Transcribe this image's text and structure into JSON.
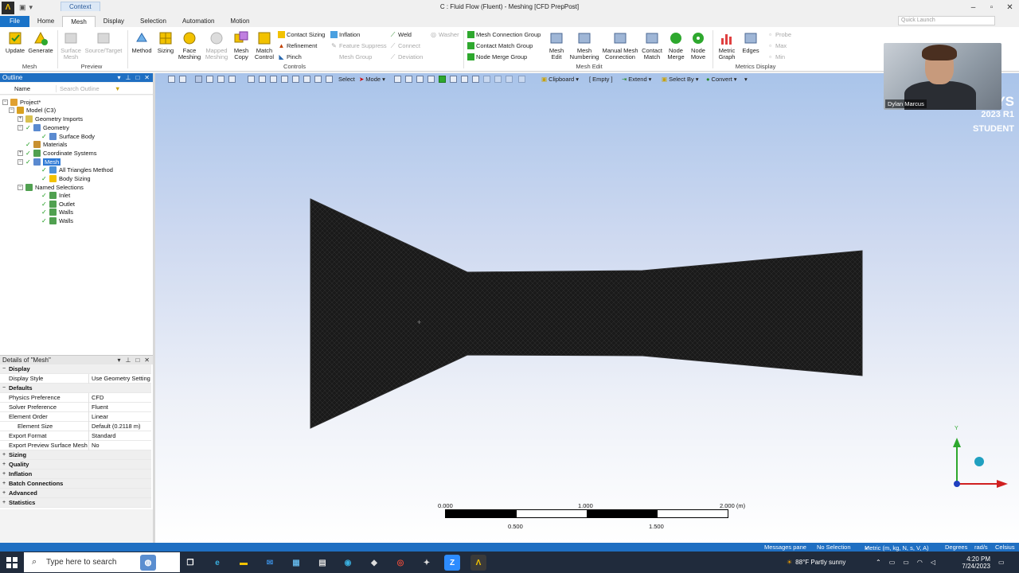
{
  "window": {
    "title": "C : Fluid Flow (Fluent) - Meshing [CFD PrepPost]",
    "context_tab": "Context",
    "controls": [
      "–",
      "▫",
      "✕"
    ]
  },
  "ribbon_tabs": [
    "File",
    "Home",
    "Mesh",
    "Display",
    "Selection",
    "Automation",
    "Motion"
  ],
  "quick_launch": "Quick Launch",
  "ribbon": {
    "update": "Update",
    "generate": "Generate",
    "group_mesh": "Mesh",
    "surface_mesh": "Surface\nMesh",
    "source_target": "Source/Target",
    "group_preview": "Preview",
    "method": "Method",
    "sizing": "Sizing",
    "face_meshing": "Face\nMeshing",
    "mapped_meshing": "Mapped\nMeshing",
    "mesh_copy": "Mesh\nCopy",
    "match_control": "Match\nControl",
    "contact_sizing": "Contact Sizing",
    "refinement": "Refinement",
    "pinch": "Pinch",
    "inflation": "Inflation",
    "feature_suppress": "Feature Suppress",
    "mesh_group": "Mesh Group",
    "weld": "Weld",
    "washer": "Washer",
    "connect": "Connect",
    "deviation": "Deviation",
    "group_controls": "Controls",
    "mesh_connection_group": "Mesh Connection Group",
    "contact_match_group": "Contact Match Group",
    "node_merge_group": "Node Merge Group",
    "mesh_edit": "Mesh\nEdit",
    "mesh_numbering": "Mesh\nNumbering",
    "manual_mesh_connection": "Manual Mesh\nConnection",
    "contact_match": "Contact\nMatch",
    "node_merge": "Node\nMerge",
    "node_move": "Node\nMove",
    "group_mesh_edit": "Mesh Edit",
    "metric_graph": "Metric\nGraph",
    "edges": "Edges",
    "probe": "Probe",
    "max": "Max",
    "min": "Min",
    "group_metrics_display": "Metrics Display"
  },
  "outline": {
    "title": "Outline",
    "col_name": "Name",
    "search_placeholder": "Search Outline",
    "nodes": [
      {
        "label": "Project*"
      },
      {
        "label": "Model (C3)"
      },
      {
        "label": "Geometry Imports"
      },
      {
        "label": "Geometry"
      },
      {
        "label": "Surface Body"
      },
      {
        "label": "Materials"
      },
      {
        "label": "Coordinate Systems"
      },
      {
        "label": "Mesh"
      },
      {
        "label": "All Triangles Method"
      },
      {
        "label": "Body Sizing"
      },
      {
        "label": "Named Selections"
      },
      {
        "label": "Inlet"
      },
      {
        "label": "Outlet"
      },
      {
        "label": "Walls"
      },
      {
        "label": "Walls"
      }
    ]
  },
  "details": {
    "title": "Details of \"Mesh\"",
    "rows": [
      {
        "k": "Display",
        "v": "",
        "sec": true,
        "sign": "−"
      },
      {
        "k": "Display Style",
        "v": "Use Geometry Setting"
      },
      {
        "k": "Defaults",
        "v": "",
        "sec": true,
        "sign": "−"
      },
      {
        "k": "Physics Preference",
        "v": "CFD"
      },
      {
        "k": "Solver Preference",
        "v": "Fluent"
      },
      {
        "k": "Element Order",
        "v": "Linear"
      },
      {
        "k": "Element Size",
        "v": "Default (0.2118 m)"
      },
      {
        "k": "Export Format",
        "v": "Standard"
      },
      {
        "k": "Export Preview Surface Mesh",
        "v": "No"
      },
      {
        "k": "Sizing",
        "v": "",
        "sec": true,
        "sign": "+"
      },
      {
        "k": "Quality",
        "v": "",
        "sec": true,
        "sign": "+"
      },
      {
        "k": "Inflation",
        "v": "",
        "sec": true,
        "sign": "+"
      },
      {
        "k": "Batch Connections",
        "v": "",
        "sec": true,
        "sign": "+"
      },
      {
        "k": "Advanced",
        "v": "",
        "sec": true,
        "sign": "+"
      },
      {
        "k": "Statistics",
        "v": "",
        "sec": true,
        "sign": "+"
      }
    ]
  },
  "viewport_toolbar": {
    "select": "Select",
    "mode": "Mode",
    "clipboard": "Clipboard",
    "empty": "[ Empty ]",
    "extend": "Extend",
    "select_by": "Select By",
    "convert": "Convert"
  },
  "watermark": {
    "brand": "YS",
    "version": "2023 R1",
    "edition": "STUDENT"
  },
  "webcam_name": "Dylan Marcus",
  "scale_bar": {
    "top_labels": [
      "0.000",
      "1.000",
      "2.000 (m)"
    ],
    "bottom_labels": [
      "0.500",
      "1.500"
    ]
  },
  "triad": {
    "y_label": "Y"
  },
  "status": {
    "messages": "Messages pane",
    "selection": "No Selection",
    "units": "Metric (m, kg, N, s, V, A)",
    "angle": "Degrees",
    "rate": "rad/s",
    "temp": "Celsius"
  },
  "taskbar": {
    "search_placeholder": "Type here to search",
    "weather": "88°F  Partly sunny",
    "time": "4:20 PM",
    "date": "7/24/2023"
  },
  "colors": {
    "accent": "#1f6fc2",
    "mesh": "#1b1b1b",
    "taskbar": "#202b3c"
  }
}
